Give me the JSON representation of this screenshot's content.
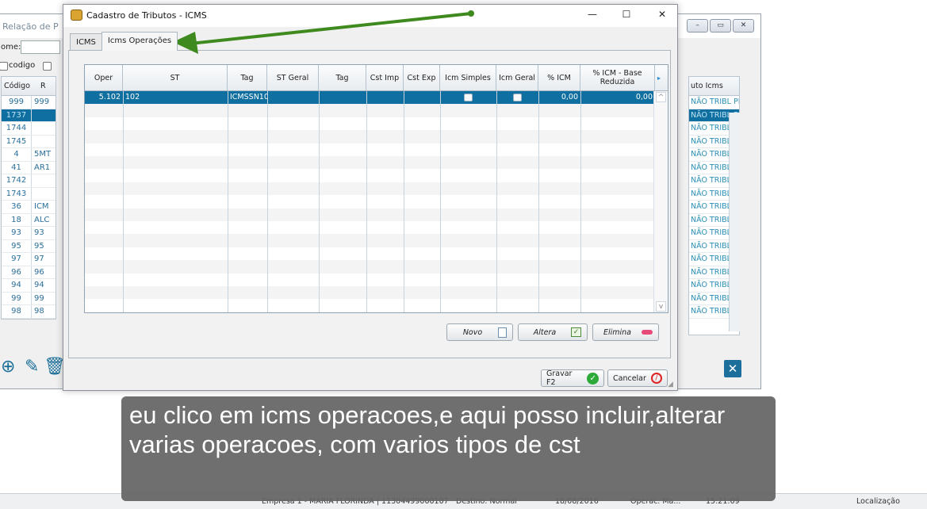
{
  "background_window": {
    "title": "Relação de P",
    "nome_label": "ome:",
    "codigo_label": "codigo",
    "left_headers": [
      "Código",
      "R"
    ],
    "left_rows": [
      {
        "code": "999",
        "ref": "999"
      },
      {
        "code": "1737",
        "ref": ""
      },
      {
        "code": "1744",
        "ref": ""
      },
      {
        "code": "1745",
        "ref": ""
      },
      {
        "code": "4",
        "ref": "5MT"
      },
      {
        "code": "41",
        "ref": "AR1"
      },
      {
        "code": "1742",
        "ref": ""
      },
      {
        "code": "1743",
        "ref": ""
      },
      {
        "code": "36",
        "ref": "ICM"
      },
      {
        "code": "18",
        "ref": "ALC"
      },
      {
        "code": "93",
        "ref": "93"
      },
      {
        "code": "95",
        "ref": "95"
      },
      {
        "code": "97",
        "ref": "97"
      },
      {
        "code": "96",
        "ref": "96"
      },
      {
        "code": "94",
        "ref": "94"
      },
      {
        "code": "99",
        "ref": "99"
      },
      {
        "code": "98",
        "ref": "98"
      }
    ],
    "right_header": "uto Icms",
    "right_cell_text": "NÃO TRIBL PI",
    "right_row_count": 17
  },
  "dialog": {
    "title": "Cadastro de Tributos - ICMS",
    "window_controls": {
      "minimize": "—",
      "maximize": "☐",
      "close": "✕"
    },
    "tabs": [
      {
        "label": "ICMS",
        "active": false
      },
      {
        "label": "Icms Operações",
        "active": true
      }
    ],
    "columns": [
      "Oper",
      "ST",
      "Tag",
      "ST Geral",
      "Tag",
      "Cst Imp",
      "Cst Exp",
      "Icm Simples",
      "Icm Geral",
      "% ICM",
      "% ICM - Base Reduzida"
    ],
    "rows": [
      {
        "oper": "5.102",
        "st": "102",
        "tag": "ICMSSN10",
        "st_geral": "",
        "tag2": "",
        "cst_imp": "",
        "cst_exp": "",
        "icm_simples": false,
        "icm_geral": false,
        "pct_icm": "0,00",
        "pct_base": "0,00"
      }
    ],
    "empty_row_count": 16,
    "buttons": {
      "novo": "Novo",
      "altera": "Altera",
      "elimina": "Elimina"
    },
    "footer": {
      "save": "Gravar F2",
      "cancel": "Cancelar"
    }
  },
  "statusbar": {
    "fragments": [
      "Empresa 1 - MARIA FLORINDA | 11304499000107",
      "Destino: Normal",
      "18/08/2016",
      "Operac. Ma...",
      "15:21:09",
      "Localização"
    ]
  },
  "caption": {
    "text": "eu clico em icms operacoes,e aqui posso incluir,alterar varias operacoes, com varios tipos de cst"
  },
  "colors": {
    "selection": "#0f6fa0",
    "accent_blue": "#1c6f9a",
    "arrow_green": "#3f8a1e",
    "caption_bg": "#646464"
  }
}
